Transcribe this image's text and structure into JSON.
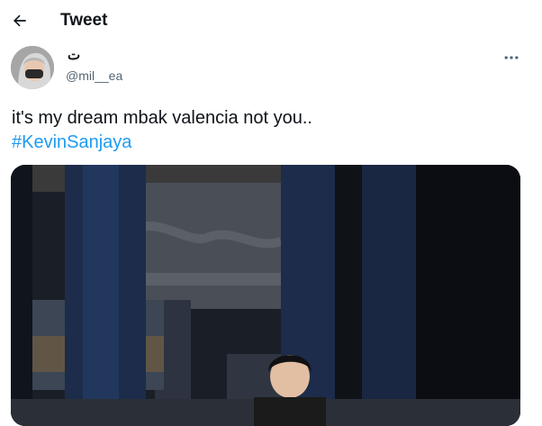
{
  "header": {
    "title": "Tweet",
    "back_icon": "arrow-left-icon"
  },
  "author": {
    "display_name": "ت",
    "handle": "@mil__ea",
    "avatar": "profile-avatar"
  },
  "tweet": {
    "text": "it's my dream mbak valencia not you..",
    "hashtag": "#KevinSanjaya"
  },
  "menu": {
    "icon": "more-horizontal-icon"
  },
  "media": {
    "description": "photo"
  },
  "colors": {
    "link": "#1d9bf0",
    "text": "#0f1419",
    "secondary": "#536471"
  }
}
